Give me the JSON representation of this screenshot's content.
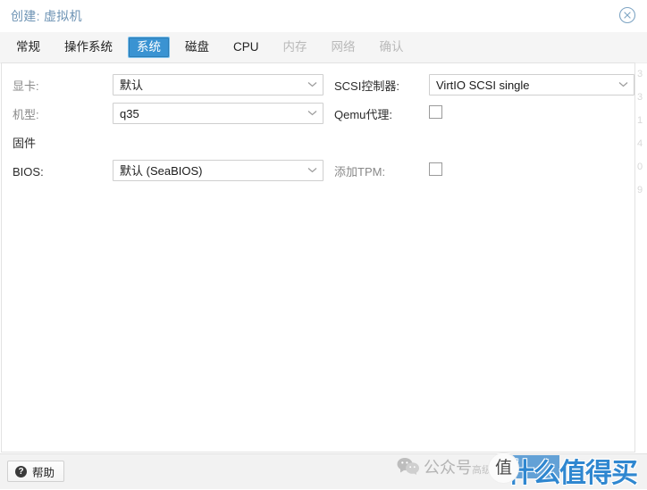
{
  "window": {
    "title": "创建: 虚拟机",
    "close_icon": "close-circle-icon"
  },
  "tabs": [
    {
      "label": "常规",
      "state": "normal"
    },
    {
      "label": "操作系统",
      "state": "normal"
    },
    {
      "label": "系统",
      "state": "active"
    },
    {
      "label": "磁盘",
      "state": "normal"
    },
    {
      "label": "CPU",
      "state": "normal"
    },
    {
      "label": "内存",
      "state": "disabled"
    },
    {
      "label": "网络",
      "state": "disabled"
    },
    {
      "label": "确认",
      "state": "disabled"
    }
  ],
  "form": {
    "left": {
      "graphic_card_label": "显卡:",
      "graphic_card_value": "默认",
      "machine_label": "机型:",
      "machine_value": "q35",
      "firmware_heading": "固件",
      "bios_label": "BIOS:",
      "bios_value": "默认 (SeaBIOS)"
    },
    "right": {
      "scsi_label": "SCSI控制器:",
      "scsi_value": "VirtIO SCSI single",
      "qemu_agent_label": "Qemu代理:",
      "qemu_agent_checked": false,
      "add_tpm_label": "添加TPM:",
      "add_tpm_checked": false
    }
  },
  "footer": {
    "help_label": "帮助",
    "help_icon": "question-mark-icon"
  },
  "watermark": {
    "wechat_icon": "wechat-icon",
    "text_primary": "公众号",
    "text_secondary": "高级",
    "logo_char": "值",
    "brand": "什么值得买"
  },
  "background_numbers": [
    "3",
    "3",
    "1",
    "4",
    "0",
    "9"
  ],
  "colors": {
    "title": "#6d93b4",
    "tab_active_bg": "#3a93d2",
    "tab_active_border": "#7ec2ef",
    "tab_disabled_text": "#b9b9b9",
    "panel_bg": "#ffffff",
    "tabbar_bg": "#f5f5f5",
    "footer_bg": "#f2f2f2",
    "field_border": "#cfcfcf",
    "brand_blue": "#2f87d0"
  }
}
